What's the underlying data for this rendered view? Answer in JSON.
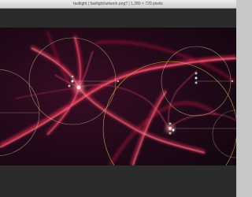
{
  "window": {
    "title": "fastlight | fastlight/artwork.png? | 1,280 × 720 pixels"
  },
  "canvas": {
    "description_icon": "image-canvas",
    "colors": {
      "background": "#1c0914",
      "glow": "#ff3b5c",
      "glow_hot": "#ffd0c8",
      "guide_circle": "#e2d7a0",
      "guide_circle_selected": "#d8b040"
    }
  },
  "guides": {
    "circle_count": 5
  }
}
